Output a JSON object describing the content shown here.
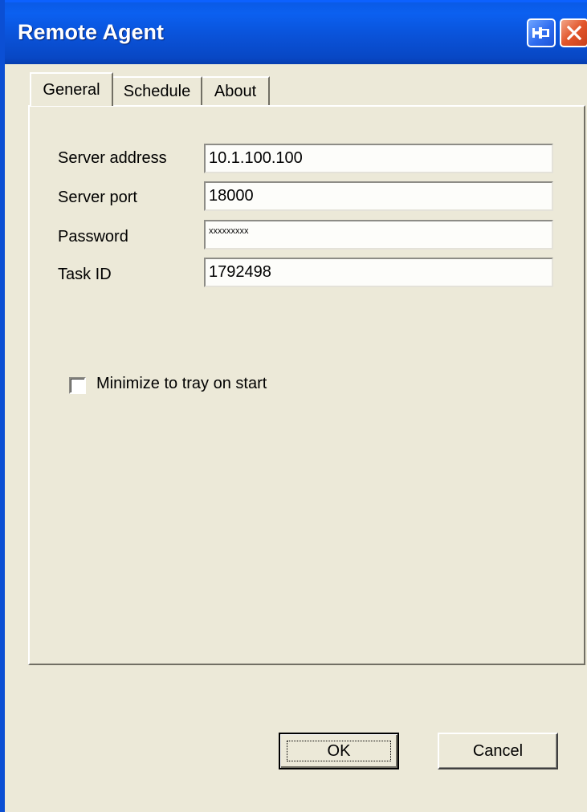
{
  "window": {
    "title": "Remote Agent"
  },
  "tabs": [
    {
      "label": "General",
      "active": true
    },
    {
      "label": "Schedule",
      "active": false
    },
    {
      "label": "About",
      "active": false
    }
  ],
  "fields": {
    "server_address": {
      "label": "Server address",
      "value": "10.1.100.100"
    },
    "server_port": {
      "label": "Server port",
      "value": "18000"
    },
    "password": {
      "label": "Password",
      "value": "xxxxxxxxx"
    },
    "task_id": {
      "label": "Task ID",
      "value": "1792498"
    }
  },
  "options": {
    "minimize_label": "Minimize to tray on start",
    "minimize_checked": false
  },
  "buttons": {
    "ok": "OK",
    "cancel": "Cancel"
  },
  "colors": {
    "titlebar": "#0A52D8",
    "face": "#ECE9D8",
    "close": "#E2552A"
  },
  "icons": {
    "pin": "pin-icon",
    "close": "close-icon"
  }
}
